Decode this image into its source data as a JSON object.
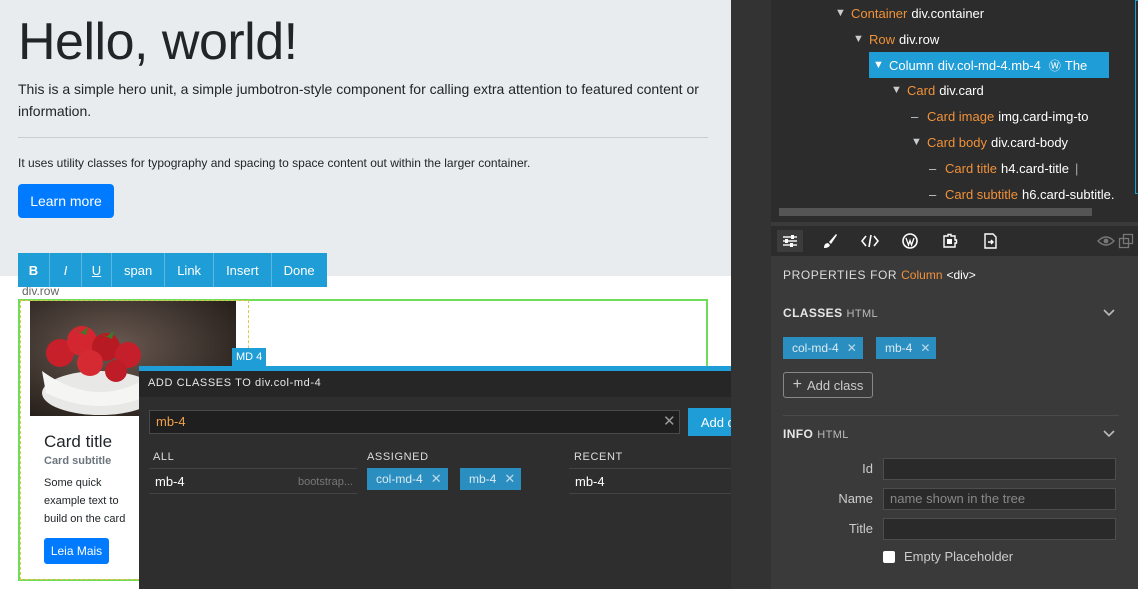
{
  "canvas": {
    "hero": {
      "title": "Hello, world!",
      "lead": "This is a simple hero unit, a simple jumbotron-style component for calling extra attention to featured content or information.",
      "text": "It uses utility classes for typography and spacing to space content out within the larger container.",
      "button": "Learn more"
    },
    "editor_toolbar": {
      "bold": "B",
      "italic": "I",
      "underline": "U",
      "span": "span",
      "link": "Link",
      "insert": "Insert",
      "done": "Done"
    },
    "row_label": "div.row",
    "col_badge": "MD 4",
    "card": {
      "title": "Card title",
      "subtitle": "Card subtitle",
      "text": "Some quick example text to build on the card title and make up the bulk of the card's content.",
      "button": "Leia Mais"
    }
  },
  "dialog": {
    "title": "ADD CLASSES TO div.col-md-4",
    "input_value": "mb-4",
    "add_button": "Add class",
    "columns": {
      "all": "ALL",
      "assigned": "ASSIGNED",
      "recent": "RECENT"
    },
    "all_items": [
      {
        "name": "mb-4",
        "source": "bootstrap..."
      }
    ],
    "assigned": [
      "col-md-4",
      "mb-4"
    ],
    "recent": [
      "mb-4"
    ]
  },
  "tree": {
    "container": {
      "name": "Container",
      "selector": "div.container"
    },
    "row": {
      "name": "Row",
      "selector": "div.row"
    },
    "column": {
      "name": "Column",
      "selector": "div.col-md-4.mb-4",
      "extra": "The"
    },
    "card": {
      "name": "Card",
      "selector": "div.card"
    },
    "card_image": {
      "name": "Card image",
      "selector": "img.card-img-to"
    },
    "card_body": {
      "name": "Card body",
      "selector": "div.card-body"
    },
    "card_title": {
      "name": "Card title",
      "selector": "h4.card-title",
      "extra": "|"
    },
    "card_subtitle": {
      "name": "Card subtitle",
      "selector": "h6.card-subtitle."
    }
  },
  "properties": {
    "for_label": "PROPERTIES FOR",
    "for_component": "Column",
    "for_tag": "<div>",
    "classes_title": "CLASSES",
    "classes_sub": "HTML",
    "classes": [
      "col-md-4",
      "mb-4"
    ],
    "add_class": "Add class",
    "info_title": "INFO",
    "info_sub": "HTML",
    "id_label": "Id",
    "id_value": "",
    "name_label": "Name",
    "name_placeholder": "name shown in the tree",
    "title_label": "Title",
    "title_value": "",
    "empty_placeholder_label": "Empty Placeholder"
  },
  "colors": {
    "accent": "#1f9dd6",
    "component_name": "#f0923a",
    "bootstrap_primary": "#007bff",
    "selection_outline": "#6fdc5a"
  },
  "icons": {
    "tabs": [
      "settings-sliders-icon",
      "brush-icon",
      "code-icon",
      "wordpress-icon",
      "puzzle-icon",
      "export-icon"
    ],
    "tree_side": [
      "eye-icon",
      "eye-off-icon",
      "collapse-left-icon",
      "layout-top-icon",
      "layout-middle-icon",
      "layout-box-icon",
      "layout-bottom-icon"
    ]
  }
}
